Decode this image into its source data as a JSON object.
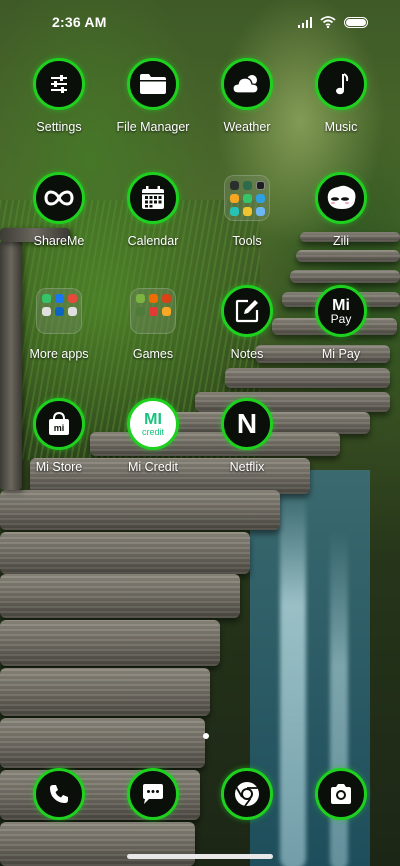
{
  "status_bar": {
    "time": "2:36 AM",
    "icons": [
      "signal-icon",
      "wifi-icon",
      "battery-icon"
    ]
  },
  "theme": {
    "ring_color": "#1ed11e",
    "icon_bg": "#0a0f0a"
  },
  "apps": {
    "row1": [
      {
        "label": "Settings",
        "icon": "sliders-icon"
      },
      {
        "label": "File Manager",
        "icon": "folder-icon"
      },
      {
        "label": "Weather",
        "icon": "cloud-sun-icon"
      },
      {
        "label": "Music",
        "icon": "music-note-icon"
      }
    ],
    "row2": [
      {
        "label": "ShareMe",
        "icon": "infinity-icon"
      },
      {
        "label": "Calendar",
        "icon": "calendar-icon"
      },
      {
        "label": "Tools",
        "icon": "folder-tools"
      },
      {
        "label": "Zili",
        "icon": "zili-face-icon"
      }
    ],
    "row3": [
      {
        "label": "More apps",
        "icon": "folder-more-apps"
      },
      {
        "label": "Games",
        "icon": "folder-games"
      },
      {
        "label": "Notes",
        "icon": "note-edit-icon"
      },
      {
        "label": "Mi Pay",
        "icon": "mi-pay-icon"
      }
    ],
    "row4": [
      {
        "label": "Mi Store",
        "icon": "shopping-bag-icon"
      },
      {
        "label": "Mi Credit",
        "icon": "mi-credit-icon"
      },
      {
        "label": "Netflix",
        "icon": "netflix-icon"
      }
    ]
  },
  "icon_text": {
    "mi_pay_top": "Mi",
    "mi_pay_bottom": "Pay",
    "mi_store": "mi",
    "mi_credit": "MI",
    "mi_credit_sub": "credit",
    "netflix": "N"
  },
  "dock": [
    {
      "icon": "phone-icon"
    },
    {
      "icon": "messages-icon"
    },
    {
      "icon": "chrome-icon"
    },
    {
      "icon": "camera-icon"
    }
  ]
}
